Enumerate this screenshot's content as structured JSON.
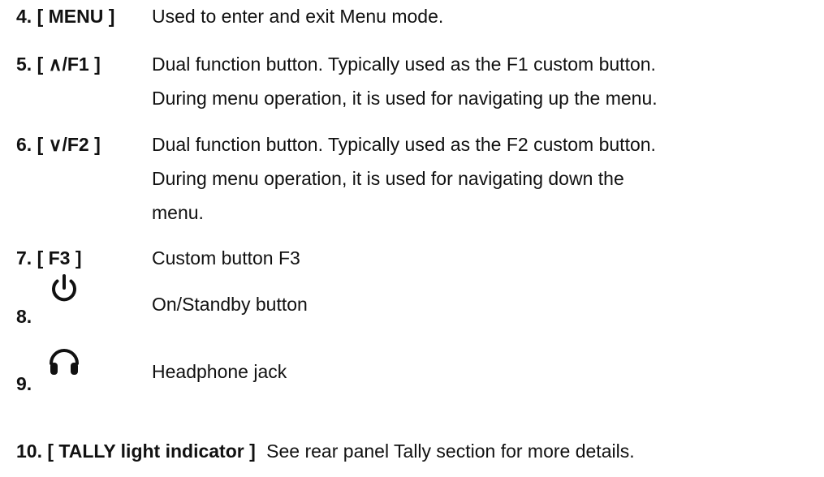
{
  "items": [
    {
      "term": "4. [ MENU ]",
      "desc": [
        "Used to enter and exit Menu mode."
      ]
    },
    {
      "term": "5. [ ∧/F1 ]",
      "desc": [
        "Dual function button. Typically used as the F1 custom button.",
        "During menu operation, it is used for navigating up the menu."
      ]
    },
    {
      "term": "6. [ ∨/F2 ]",
      "desc": [
        "Dual function button. Typically used as the F2 custom button.",
        "During menu operation, it is used for navigating down the",
        "menu."
      ]
    },
    {
      "term": "7. [ F3 ]",
      "desc": [
        "Custom button F3"
      ]
    },
    {
      "term": "8.",
      "icon": "power-icon",
      "desc": [
        "On/Standby button"
      ]
    },
    {
      "term": "9.",
      "icon": "headphone-icon",
      "desc": [
        "Headphone jack"
      ]
    },
    {
      "term": "10. [ TALLY light indicator ]",
      "desc": [
        "See rear panel Tally section for more details."
      ]
    }
  ]
}
